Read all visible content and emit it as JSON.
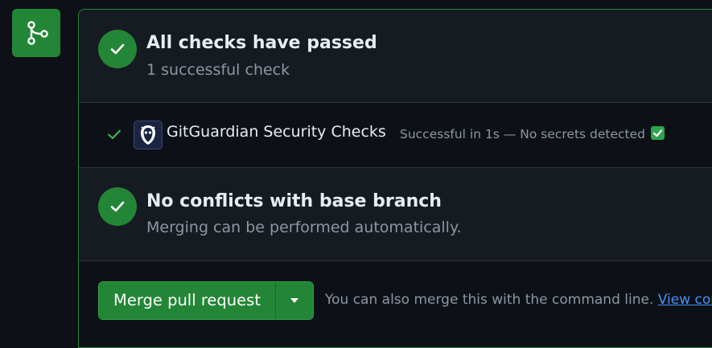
{
  "checks_summary": {
    "title": "All checks have passed",
    "subtitle": "1 successful check"
  },
  "check_item": {
    "name": "GitGuardian Security Checks",
    "description": "Successful in 1s — No secrets detected",
    "icon": "gitguardian-logo",
    "status": "success"
  },
  "conflicts": {
    "title": "No conflicts with base branch",
    "subtitle": "Merging can be performed automatically."
  },
  "merge": {
    "button_label": "Merge pull request",
    "help_text": "You can also merge this with the command line. ",
    "link_text": "View con"
  },
  "colors": {
    "success": "#238636",
    "link": "#4493f8",
    "background": "#0d1117",
    "panel": "#161b22"
  }
}
